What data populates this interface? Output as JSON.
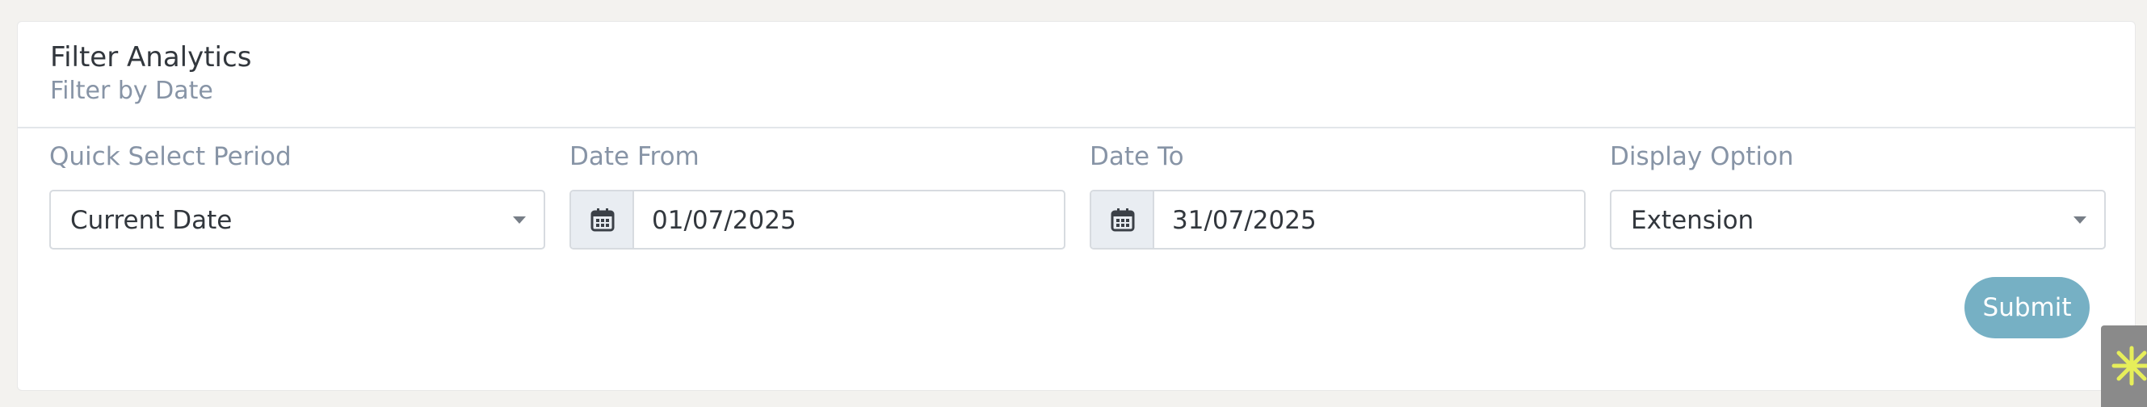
{
  "header": {
    "title": "Filter Analytics",
    "subtitle": "Filter by Date"
  },
  "fields": {
    "quick_select": {
      "label": "Quick Select Period",
      "value": "Current Date"
    },
    "date_from": {
      "label": "Date From",
      "value": "01/07/2025"
    },
    "date_to": {
      "label": "Date To",
      "value": "31/07/2025"
    },
    "display_option": {
      "label": "Display Option",
      "value": "Extension"
    }
  },
  "actions": {
    "submit_label": "Submit"
  },
  "icons": {
    "date_addon": "calendar-icon",
    "select_caret": "chevron-down-icon",
    "corner_widget": "asterisk-icon"
  },
  "colors": {
    "submit_bg": "#76b0c4",
    "label_text": "#8794a6",
    "value_text": "#32373d",
    "widget_accent": "#e6ee5a"
  }
}
